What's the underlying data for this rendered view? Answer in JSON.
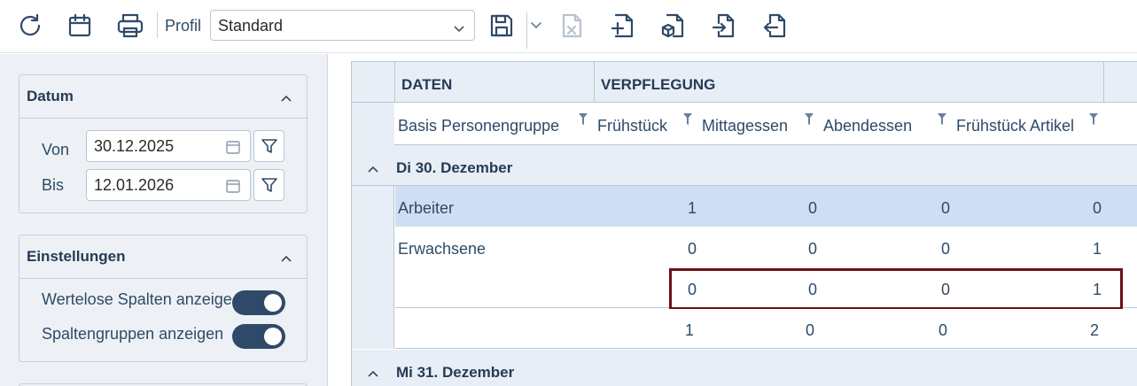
{
  "toolbar": {
    "icons": [
      "refresh-icon",
      "calendar-icon",
      "print-icon",
      "save-icon",
      "dropdown-chevron-icon",
      "delete-export-icon",
      "new-file-icon",
      "export-package-icon",
      "import-icon",
      "export-icon"
    ],
    "profil_label": "Profil",
    "profil_value": "Standard"
  },
  "datum": {
    "title": "Datum",
    "von_label": "Von",
    "von_value": "30.12.2025",
    "bis_label": "Bis",
    "bis_value": "12.01.2026"
  },
  "einstellungen": {
    "title": "Einstellungen",
    "toggles": [
      {
        "label": "Wertelose Spalten anzeigen",
        "on": true
      },
      {
        "label": "Spaltengruppen anzeigen",
        "on": true
      }
    ]
  },
  "grid": {
    "groups": [
      "DATEN",
      "VERPFLEGUNG"
    ],
    "columns": [
      "Basis Personengruppe",
      "Frühstück",
      "Mittagessen",
      "Abendessen",
      "Frühstück Artikel"
    ],
    "days": [
      {
        "label": "Di 30. Dezember",
        "rows": [
          {
            "name": "Arbeiter",
            "values": [
              "1",
              "0",
              "0",
              "0"
            ]
          },
          {
            "name": "Erwachsene",
            "values": [
              "0",
              "0",
              "0",
              "1"
            ]
          },
          {
            "name": "",
            "values": [
              "0",
              "0",
              "0",
              "1"
            ]
          }
        ],
        "totals": [
          "1",
          "0",
          "0",
          "2"
        ]
      },
      {
        "label": "Mi 31. Dezember"
      }
    ]
  },
  "colors": {
    "accent": "#2f4a68",
    "selected_row": "#cfdff3",
    "highlight_border": "#6e0f15",
    "panel_bg": "#edf1f5"
  }
}
